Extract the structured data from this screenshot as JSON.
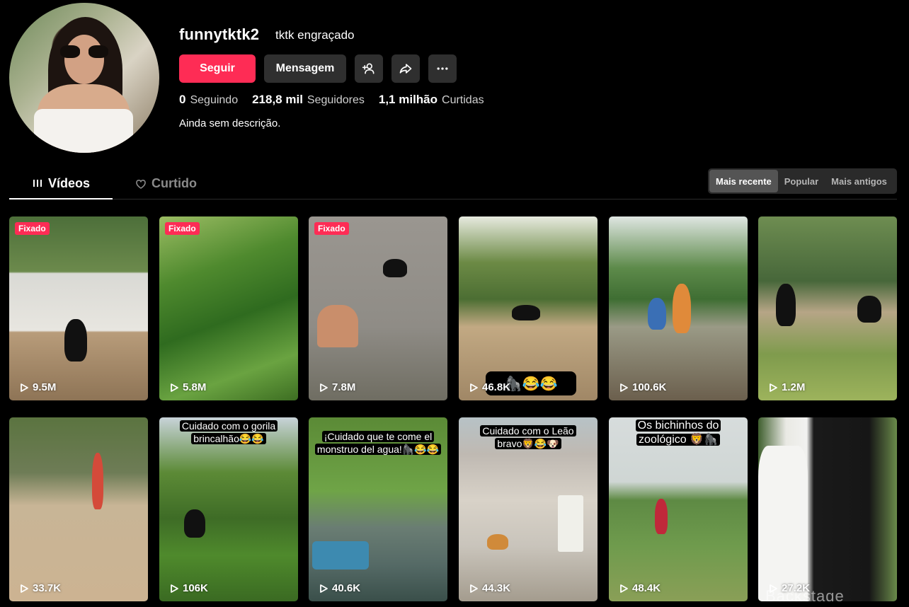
{
  "profile": {
    "username": "funnytktk2",
    "nickname": "tktk engraçado",
    "bio": "Ainda sem descrição.",
    "follow_label": "Seguir",
    "message_label": "Mensagem",
    "stats": [
      {
        "value": "0",
        "label": "Seguindo"
      },
      {
        "value": "218,8 mil",
        "label": "Seguidores"
      },
      {
        "value": "1,1 milhão",
        "label": "Curtidas"
      }
    ]
  },
  "tabs": {
    "videos": "Vídeos",
    "liked": "Curtido"
  },
  "sort": {
    "options": [
      "Mais recente",
      "Popular",
      "Mais antigos"
    ],
    "active": "Mais recente"
  },
  "pinned_label": "Fixado",
  "videos": [
    {
      "views": "9.5M",
      "pinned": true
    },
    {
      "views": "5.8M",
      "pinned": true
    },
    {
      "views": "7.8M",
      "pinned": true
    },
    {
      "views": "46.8K",
      "overlay": "🦍😂😂"
    },
    {
      "views": "100.6K"
    },
    {
      "views": "1.2M"
    },
    {
      "views": "33.7K"
    },
    {
      "views": "106K",
      "caption_lines": [
        "Cuidado com o gorila",
        "brincalhão😂😂"
      ]
    },
    {
      "views": "40.6K",
      "caption_lines": [
        "¡Cuidado que te come el",
        "monstruo del agua!🦍😂😂"
      ]
    },
    {
      "views": "44.3K",
      "caption_lines": [
        "Cuidado com o Leão",
        "bravo🦁😂🐶"
      ]
    },
    {
      "views": "48.4K",
      "caption_lines": [
        "Os bichinhos do",
        "zoológico 🦁🦍"
      ]
    },
    {
      "views": "27.2K",
      "watermark": "Backstage"
    }
  ],
  "colors": {
    "accent": "#fe2c55",
    "background": "#000000",
    "button_dark": "#2f2f2f"
  }
}
